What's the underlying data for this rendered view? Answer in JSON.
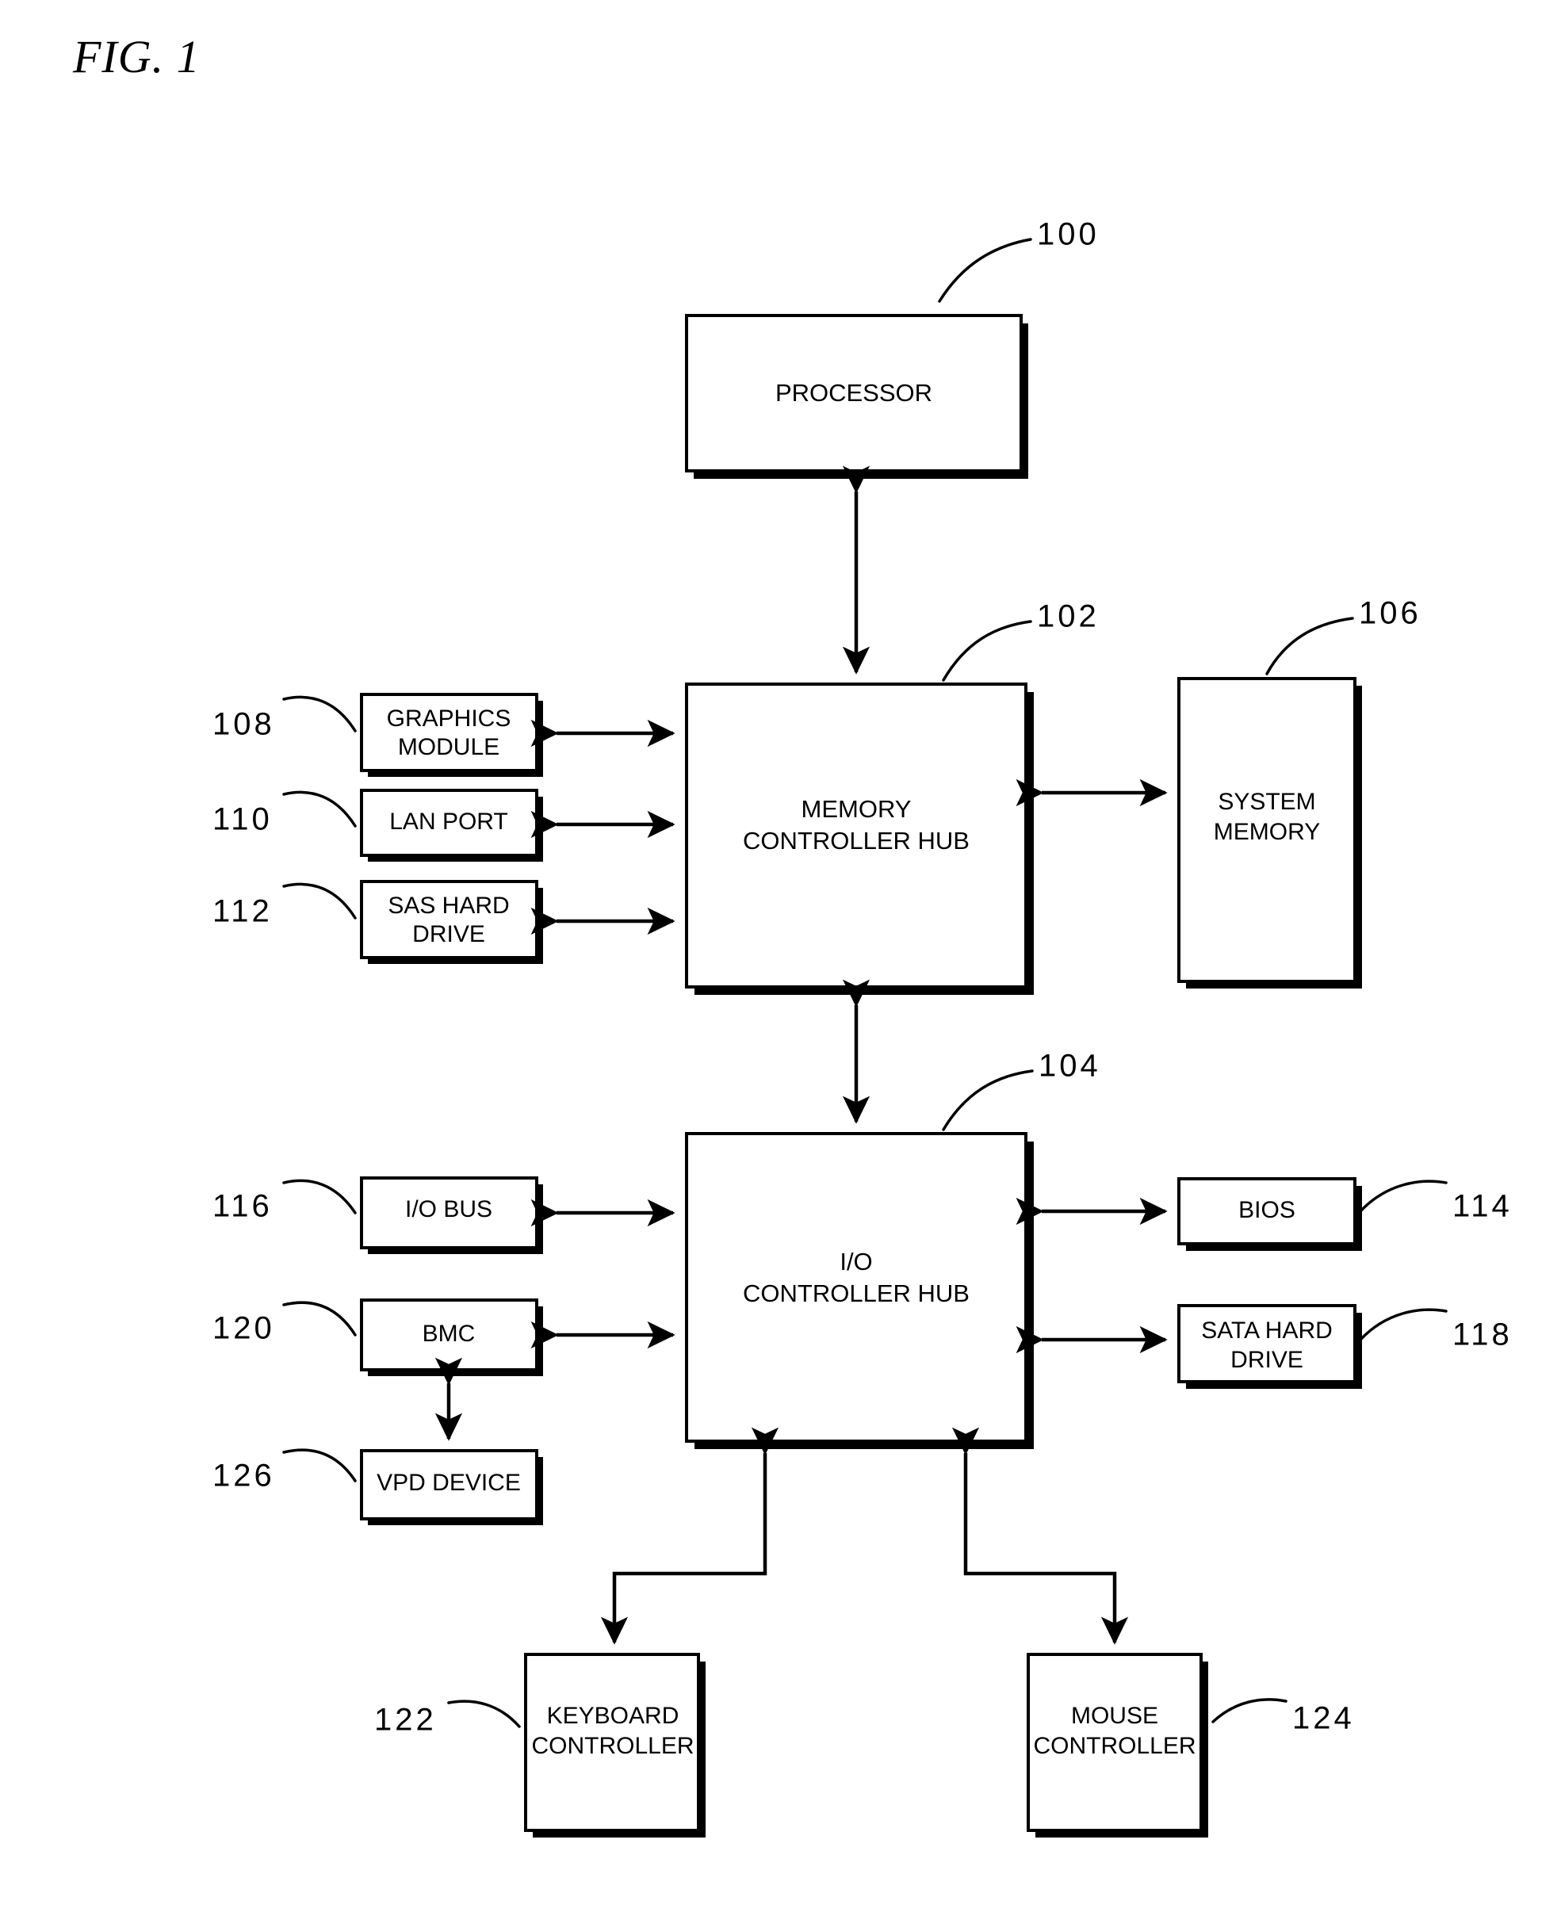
{
  "figure": {
    "title": "FIG. 1",
    "type": "patent-block-diagram",
    "description": "Computer system block diagram showing processor, memory controller hub, I/O controller hub and attached peripherals"
  },
  "colors": {
    "line": "#000000",
    "background": "#ffffff",
    "text": "#000000"
  },
  "blocks": [
    {
      "id": "processor",
      "ref": "100",
      "lines": [
        "PROCESSOR"
      ]
    },
    {
      "id": "memory-controller-hub",
      "ref": "102",
      "lines": [
        "MEMORY",
        "CONTROLLER HUB"
      ]
    },
    {
      "id": "io-controller-hub",
      "ref": "104",
      "lines": [
        "I/O",
        "CONTROLLER HUB"
      ]
    },
    {
      "id": "system-memory",
      "ref": "106",
      "lines": [
        "SYSTEM",
        "MEMORY"
      ]
    },
    {
      "id": "graphics-module",
      "ref": "108",
      "lines": [
        "GRAPHICS",
        "MODULE"
      ]
    },
    {
      "id": "lan-port",
      "ref": "110",
      "lines": [
        "LAN PORT"
      ]
    },
    {
      "id": "sas-hard-drive",
      "ref": "112",
      "lines": [
        "SAS HARD",
        "DRIVE"
      ]
    },
    {
      "id": "bios",
      "ref": "114",
      "lines": [
        "BIOS"
      ]
    },
    {
      "id": "io-bus",
      "ref": "116",
      "lines": [
        "I/O BUS"
      ]
    },
    {
      "id": "sata-hard-drive",
      "ref": "118",
      "lines": [
        "SATA HARD",
        "DRIVE"
      ]
    },
    {
      "id": "bmc",
      "ref": "120",
      "lines": [
        "BMC"
      ]
    },
    {
      "id": "keyboard-controller",
      "ref": "122",
      "lines": [
        "KEYBOARD",
        "CONTROLLER"
      ]
    },
    {
      "id": "mouse-controller",
      "ref": "124",
      "lines": [
        "MOUSE",
        "CONTROLLER"
      ]
    },
    {
      "id": "vpd-device",
      "ref": "126",
      "lines": [
        "VPD DEVICE"
      ]
    }
  ],
  "labels": {
    "processor": "PROCESSOR",
    "mch_line1": "MEMORY",
    "mch_line2": "CONTROLLER HUB",
    "ich_line1": "I/O",
    "ich_line2": "CONTROLLER HUB",
    "sysmem_line1": "SYSTEM",
    "sysmem_line2": "MEMORY",
    "graphics_line1": "GRAPHICS",
    "graphics_line2": "MODULE",
    "lanport": "LAN PORT",
    "sas_line1": "SAS HARD",
    "sas_line2": "DRIVE",
    "bios": "BIOS",
    "iobus": "I/O BUS",
    "sata_line1": "SATA HARD",
    "sata_line2": "DRIVE",
    "bmc": "BMC",
    "kbd_line1": "KEYBOARD",
    "kbd_line2": "CONTROLLER",
    "mouse_line1": "MOUSE",
    "mouse_line2": "CONTROLLER",
    "vpd": "VPD DEVICE"
  },
  "refs": {
    "processor": "100",
    "mch": "102",
    "ich": "104",
    "sysmem": "106",
    "graphics": "108",
    "lanport": "110",
    "sas": "112",
    "bios": "114",
    "iobus": "116",
    "sata": "118",
    "bmc": "120",
    "keyboard": "122",
    "mouse": "124",
    "vpd": "126"
  },
  "connections": [
    {
      "from": "processor",
      "to": "memory-controller-hub",
      "arrows": "both",
      "orientation": "vertical"
    },
    {
      "from": "memory-controller-hub",
      "to": "io-controller-hub",
      "arrows": "both",
      "orientation": "vertical"
    },
    {
      "from": "memory-controller-hub",
      "to": "system-memory",
      "arrows": "both",
      "orientation": "horizontal"
    },
    {
      "from": "graphics-module",
      "to": "memory-controller-hub",
      "arrows": "both",
      "orientation": "horizontal"
    },
    {
      "from": "lan-port",
      "to": "memory-controller-hub",
      "arrows": "both",
      "orientation": "horizontal"
    },
    {
      "from": "sas-hard-drive",
      "to": "memory-controller-hub",
      "arrows": "both",
      "orientation": "horizontal"
    },
    {
      "from": "io-bus",
      "to": "io-controller-hub",
      "arrows": "both",
      "orientation": "horizontal"
    },
    {
      "from": "bmc",
      "to": "io-controller-hub",
      "arrows": "both",
      "orientation": "horizontal"
    },
    {
      "from": "io-controller-hub",
      "to": "bios",
      "arrows": "both",
      "orientation": "horizontal"
    },
    {
      "from": "io-controller-hub",
      "to": "sata-hard-drive",
      "arrows": "both",
      "orientation": "horizontal"
    },
    {
      "from": "bmc",
      "to": "vpd-device",
      "arrows": "both",
      "orientation": "vertical"
    },
    {
      "from": "io-controller-hub",
      "to": "keyboard-controller",
      "arrows": "both",
      "orientation": "stepped"
    },
    {
      "from": "io-controller-hub",
      "to": "mouse-controller",
      "arrows": "both",
      "orientation": "stepped"
    }
  ]
}
